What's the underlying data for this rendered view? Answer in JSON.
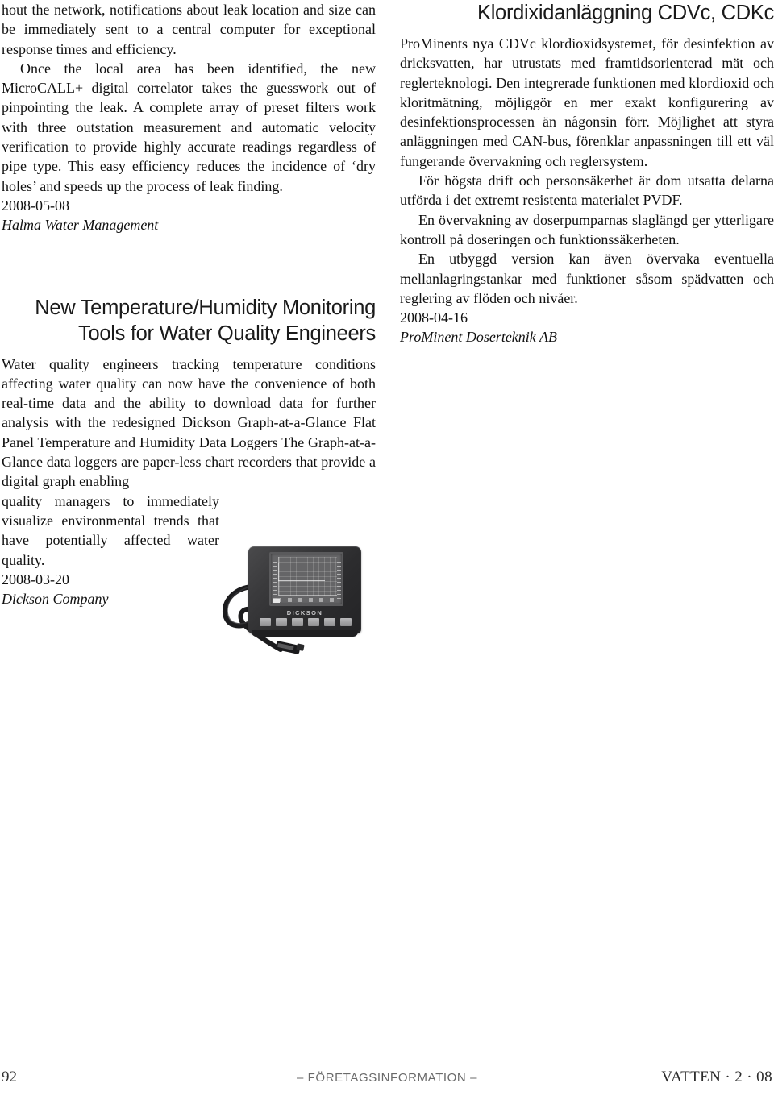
{
  "page": {
    "number": "92",
    "footer_center": "– FÖRETAGSINFORMATION –",
    "footer_right": "VATTEN · 2 · 08"
  },
  "left_column": {
    "article_continued": {
      "paragraphs": [
        "hout the network, notifications about leak location and size can be immediately sent to a central computer for exceptional response times and efficiency.",
        "Once the local area has been identified, the new MicroCALL+ digital correlator takes the guesswork out of pinpointing the leak. A complete array of preset filters work with three outstation measurement and automatic velocity verification to provide highly accurate readings regardless of pipe type. This easy efficiency reduces the incidence of ‘dry holes’ and speeds up the process of leak finding."
      ],
      "date": "2008-05-08",
      "company": "Halma Water Management"
    },
    "article_two": {
      "title": "New Temperature/Humidity Monitoring Tools for Water Quality Engineers",
      "paragraph_wide": "Water quality engineers tracking temperature conditions affecting water quality can now have the convenience of both real-time data and the ability to download data for further analysis with the redesigned Dickson Graph-at-a-Glance Flat Panel Temperature and Humidity Data Loggers The Graph-at-a-Glance data loggers are paper-less chart recorders that provide a digital graph enabling",
      "paragraph_narrow": "quality managers to immediately visualize environmental trends that have potentially affected water quality.",
      "date": "2008-03-20",
      "company": "Dickson Company",
      "photo": {
        "brand": "DICKSON",
        "caption": "flat panel temperature and humidity data logger",
        "button_count": 6
      }
    }
  },
  "right_column": {
    "article": {
      "title": "Klordixidanläggning CDVc, CDKc",
      "paragraphs": [
        "ProMinents nya CDVc klordioxidsystemet, för desinfektion av dricksvatten, har utrustats med framtidsorienterad mät och reglerteknologi. Den integrerade funktionen med klordioxid och kloritmätning, möjliggör en mer exakt konfigurering av desinfektionsprocessen än någonsin förr. Möjlighet att styra anläggningen med CAN-bus, förenklar anpassningen till ett väl fungerande övervakning och reglersystem.",
        "För högsta drift och personsäkerhet är dom utsatta delarna utförda i det extremt resistenta materialet PVDF.",
        "En övervakning av doserpumparnas slaglängd ger ytterligare kontroll på doseringen och funktionssäkerheten.",
        "En utbyggd version kan även övervaka eventuella mellanlagringstankar med funktioner såsom spädvatten och reglering av flöden och nivåer."
      ],
      "date": "2008-04-16",
      "company": "ProMinent Doserteknik AB"
    }
  }
}
